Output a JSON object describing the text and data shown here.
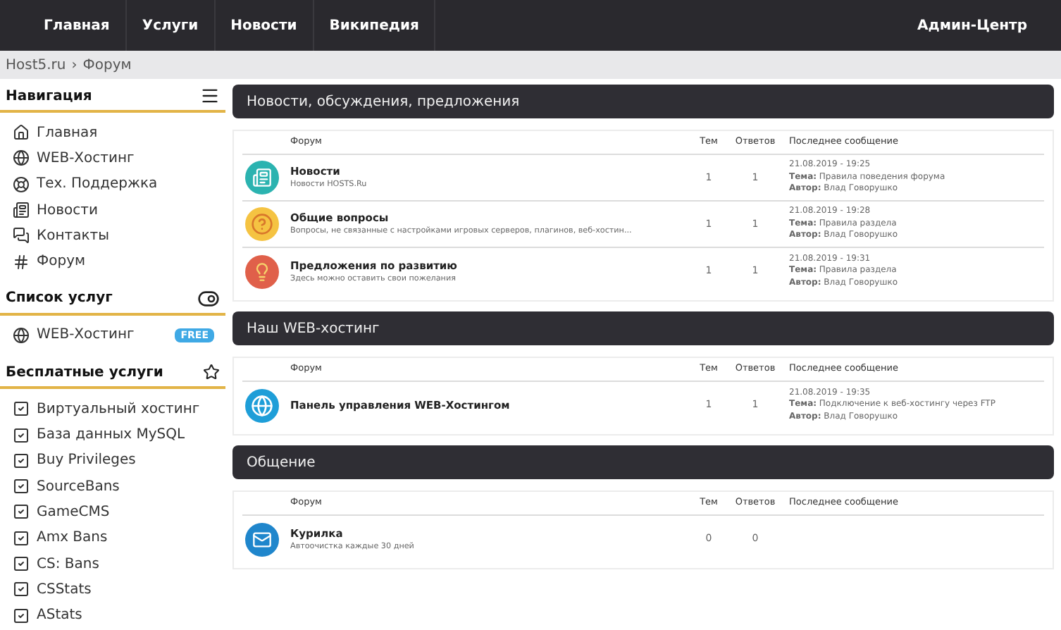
{
  "top_nav": {
    "items": [
      "Главная",
      "Услуги",
      "Новости",
      "Википедия"
    ],
    "right": "Админ-Центр"
  },
  "breadcrumb": {
    "home": "Host5.ru",
    "separator": "›",
    "current": "Форум"
  },
  "sidebar": {
    "sections": [
      {
        "title": "Навигация",
        "kind": "nav",
        "items": [
          {
            "label": "Главная"
          },
          {
            "label": "WEB-Хостинг"
          },
          {
            "label": "Тех. Поддержка"
          },
          {
            "label": "Новости"
          },
          {
            "label": "Контакты"
          },
          {
            "label": "Форум"
          }
        ]
      },
      {
        "title": "Список услуг",
        "kind": "services",
        "items": [
          {
            "label": "WEB-Хостинг",
            "badge": "FREE"
          }
        ]
      },
      {
        "title": "Бесплатные услуги",
        "kind": "free",
        "items": [
          {
            "label": "Виртуальный хостинг"
          },
          {
            "label": "База данных MySQL"
          },
          {
            "label": "Buy Privileges"
          },
          {
            "label": "SourceBans"
          },
          {
            "label": "GameCMS"
          },
          {
            "label": "Amx Bans"
          },
          {
            "label": "CS: Bans"
          },
          {
            "label": "CSStats"
          },
          {
            "label": "AStats"
          }
        ]
      }
    ]
  },
  "categories": [
    {
      "title": "Новости, обсуждения, предложения",
      "columns": [
        "Форум",
        "Тем",
        "Ответов",
        "Последнее сообщение"
      ],
      "rows": [
        {
          "kind": "news",
          "name": "Новости",
          "description": "Новости HOSTS.Ru",
          "topics": "1",
          "replies": "1",
          "last": [
            "21.08.2019 - 19:25",
            "**Тема:** Правила поведения форума",
            "**Автор:** Влад Говорушко"
          ]
        },
        {
          "kind": "question",
          "name": "Общие вопросы",
          "description": "Вопросы, не связанные с настройками игровых серверов, плагинов, веб-хостин...",
          "topics": "1",
          "replies": "1",
          "last": [
            "21.08.2019 - 19:28",
            "**Тема:** Правила раздела",
            "**Автор:** Влад Говорушко"
          ]
        },
        {
          "kind": "idea",
          "name": "Предложения по развитию",
          "description": "Здесь можно оставить свои пожелания",
          "topics": "1",
          "replies": "1",
          "last": [
            "21.08.2019 - 19:31",
            "**Тема:** Правила раздела",
            "**Автор:** Влад Говорушко"
          ]
        }
      ]
    },
    {
      "title": "Наш WEB-хостинг",
      "columns": [
        "Форум",
        "Тем",
        "Ответов",
        "Последнее сообщение"
      ],
      "rows": [
        {
          "kind": "globe",
          "name": "Панель управления WEB-Хостингом",
          "topics": "1",
          "replies": "1",
          "last": [
            "21.08.2019 - 19:35",
            "**Тема:** Подключение к веб-хостингу через FTP",
            "**Автор:** Влад Говорушко"
          ]
        }
      ]
    },
    {
      "title": "Общение",
      "columns": [
        "Форум",
        "Тем",
        "Ответов",
        "Последнее сообщение"
      ],
      "rows": [
        {
          "kind": "mail",
          "name": "Курилка",
          "description": "Автоочистка каждые 30 дней",
          "topics": "0",
          "replies": "0"
        }
      ]
    }
  ]
}
